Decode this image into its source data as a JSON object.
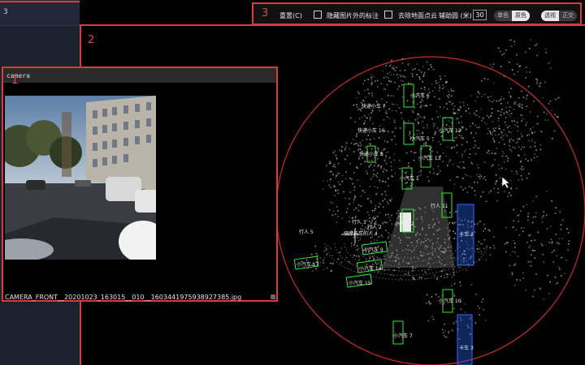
{
  "sidebar": {
    "tab_label": "3"
  },
  "toolbar": {
    "region_number": "3",
    "reset_label": "重置(C)",
    "hide_outside_label": "隐藏图片外的标注",
    "remove_ground_label": "去除地面点云",
    "aux_circle_label": "辅助圆 (米)",
    "aux_circle_value": "30",
    "color_mode": {
      "options": [
        "单色",
        "原色"
      ],
      "selected": "原色"
    },
    "view_mode": {
      "options": [
        "透视",
        "正交"
      ],
      "selected": "正交"
    }
  },
  "main_region_number": "2",
  "camera_panel": {
    "region_number": "1",
    "title": "camera",
    "filename": "CAMERA_FRONT__20201023_163015__010__1603441975938927385.jpg"
  },
  "lidar": {
    "colors": {
      "car": "#39e639",
      "truck": "#2f6bff",
      "ring": "#cc2a2a",
      "points": "#a0a0a0"
    },
    "objects": [
      {
        "label": "小汽车 6",
        "category": "car",
        "selected": true
      },
      {
        "label": "快递小车 7",
        "category": "car",
        "selected": false
      },
      {
        "label": "快递小车 16",
        "category": "car",
        "selected": false
      },
      {
        "label": "小汽车 5",
        "category": "car",
        "selected": false
      },
      {
        "label": "小汽车 12",
        "category": "car",
        "selected": false
      },
      {
        "label": "快递小车 8",
        "category": "car",
        "selected": false
      },
      {
        "label": "小汽车 13",
        "category": "car",
        "selected": false
      },
      {
        "label": "小汽车 1",
        "category": "car",
        "selected": false
      },
      {
        "label": "行人 11",
        "category": "car",
        "selected": false
      },
      {
        "label": "小汽车 2",
        "category": "car",
        "selected": false
      },
      {
        "label": "卡车 2",
        "category": "truck",
        "selected": false
      },
      {
        "label": "行人 3",
        "category": "person",
        "selected": false
      },
      {
        "label": "行人 2",
        "category": "person",
        "selected": false
      },
      {
        "label": "行人 5",
        "category": "person",
        "selected": false
      },
      {
        "label": "骑摩托车的人 4",
        "category": "person",
        "selected": false
      },
      {
        "label": "小汽车 9",
        "category": "car",
        "selected": false
      },
      {
        "label": "小汽车 17",
        "category": "car",
        "selected": false
      },
      {
        "label": "小汽车 14",
        "category": "car",
        "selected": false
      },
      {
        "label": "小汽车 15",
        "category": "car",
        "selected": false
      },
      {
        "label": "小汽车 10",
        "category": "car",
        "selected": false
      },
      {
        "label": "小汽车 7",
        "category": "car",
        "selected": false
      },
      {
        "label": "卡车 3",
        "category": "truck",
        "selected": false
      }
    ]
  }
}
